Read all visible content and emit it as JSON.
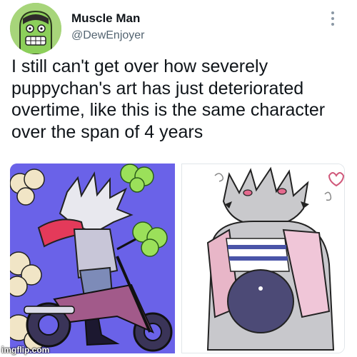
{
  "user": {
    "display_name": "Muscle Man",
    "handle": "@DewEnjoyer",
    "avatar_icon": "muscle-man-avatar"
  },
  "tweet": {
    "text": "I still can't get over how severely\npuppychan's art has just deteriorated\novertime, like this is the same character\nover the span of 4 years",
    "more_icon": "more-options-icon"
  },
  "media": {
    "left_bg": "#6a62e8",
    "right_bg": "#ffffff"
  },
  "watermark": "imgflip.com"
}
